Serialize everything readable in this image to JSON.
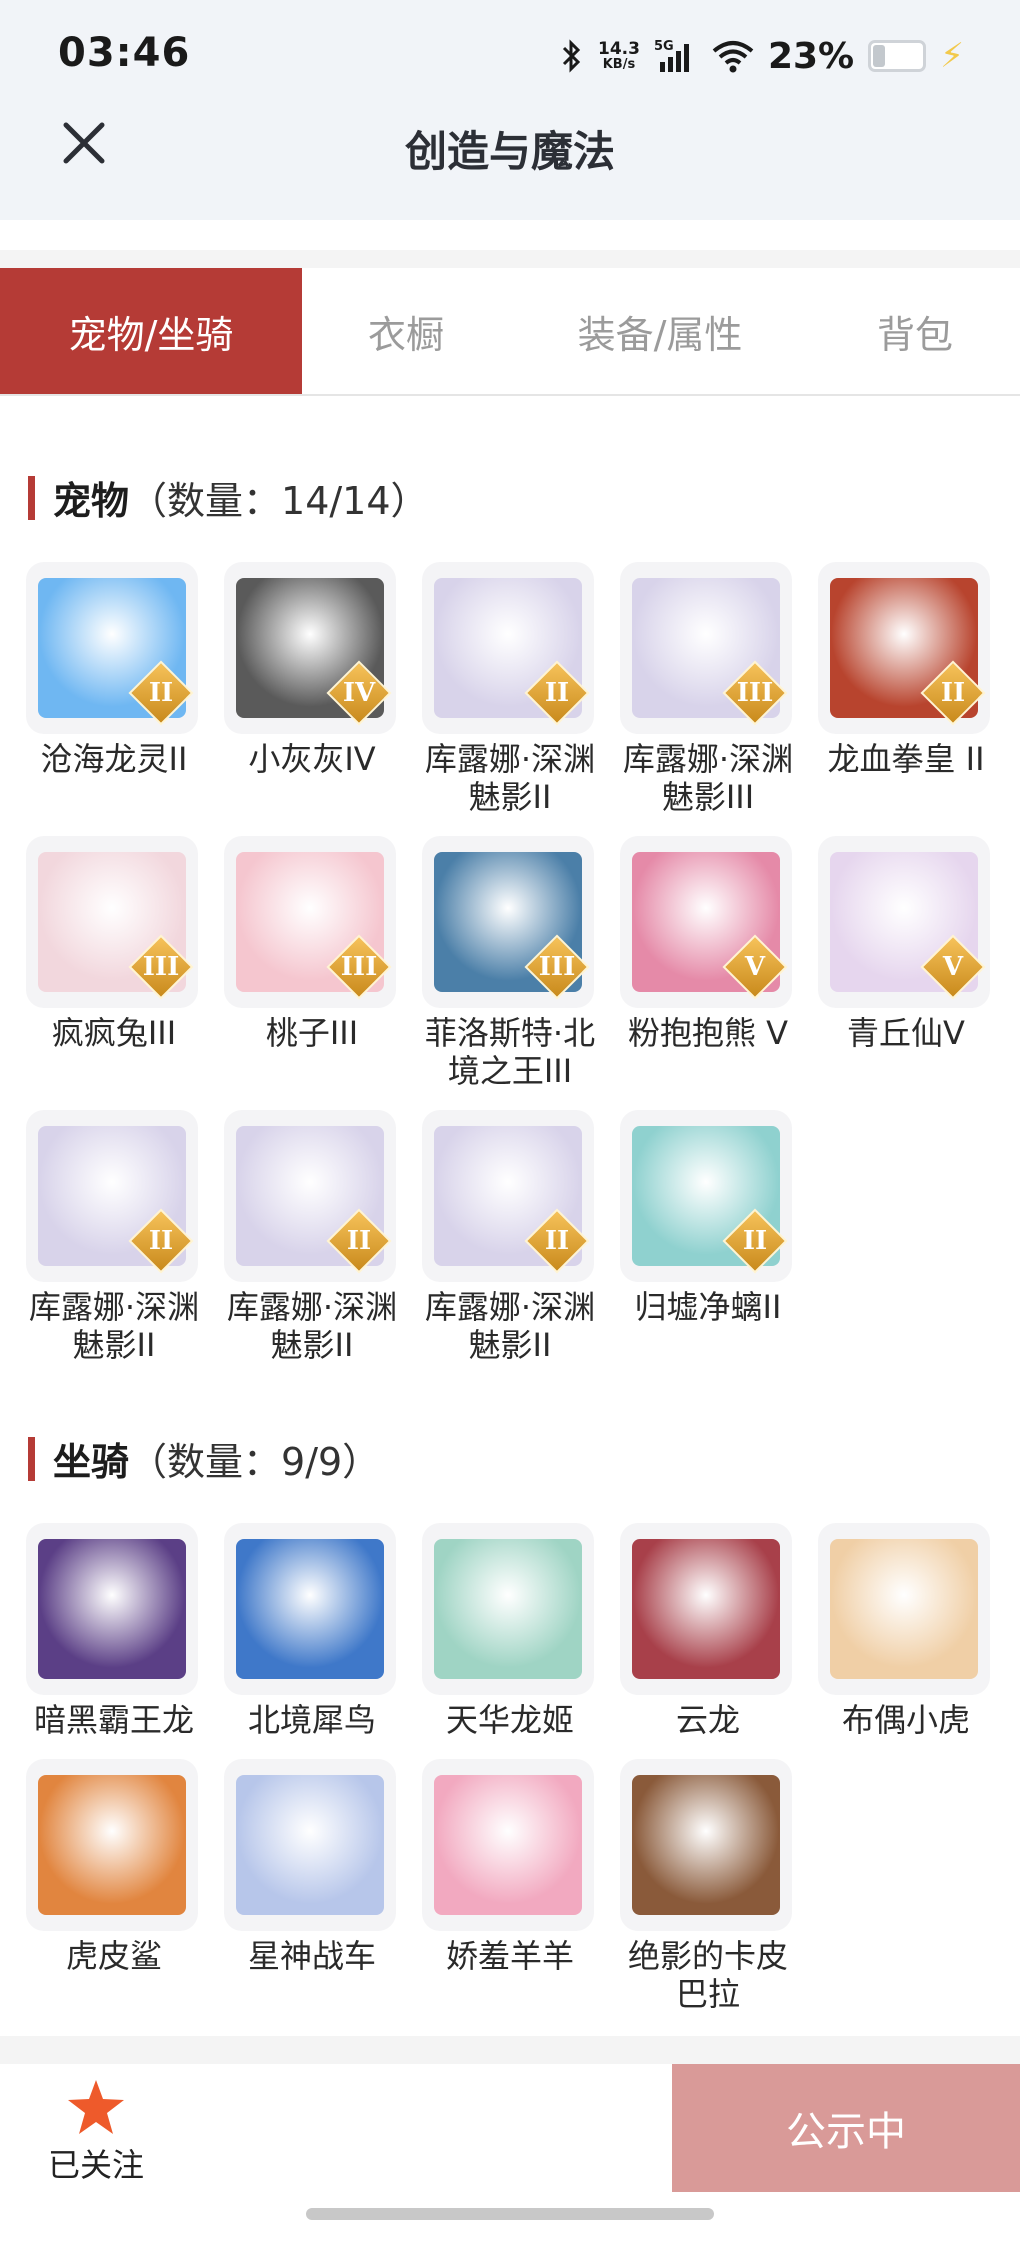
{
  "status": {
    "time": "03:46",
    "net_speed_value": "14.3",
    "net_speed_unit": "KB/s",
    "network": "5G",
    "battery_pct": "23%",
    "battery_level": 0.23
  },
  "header": {
    "title": "创造与魔法",
    "close_icon": "close-icon"
  },
  "tabs": [
    {
      "label": "宠物/坐骑",
      "active": true
    },
    {
      "label": "衣橱",
      "active": false
    },
    {
      "label": "装备/属性",
      "active": false
    },
    {
      "label": "背包",
      "active": false
    }
  ],
  "pets": {
    "title": "宠物",
    "count": "（数量：14/14）",
    "items": [
      {
        "label": "沧海龙灵II",
        "badge": "II",
        "color": "#6fb7f2"
      },
      {
        "label": "小灰灰IV",
        "badge": "IV",
        "color": "#5a5a5a"
      },
      {
        "label": "库露娜·深渊魅影II",
        "badge": "II",
        "color": "#d8d3ea"
      },
      {
        "label": "库露娜·深渊魅影III",
        "badge": "III",
        "color": "#d8d3ea"
      },
      {
        "label": "龙血拳皇 II",
        "badge": "II",
        "color": "#b8442e"
      },
      {
        "label": "疯疯兔III",
        "badge": "III",
        "color": "#f2d7dd"
      },
      {
        "label": "桃子III",
        "badge": "III",
        "color": "#f5c6cf"
      },
      {
        "label": "菲洛斯特·北境之王III",
        "badge": "III",
        "color": "#4b7fa8"
      },
      {
        "label": "粉抱抱熊 V",
        "badge": "V",
        "color": "#e58aa8"
      },
      {
        "label": "青丘仙V",
        "badge": "V",
        "color": "#e6d6ee"
      },
      {
        "label": "库露娜·深渊魅影II",
        "badge": "II",
        "color": "#d8d3ea"
      },
      {
        "label": "库露娜·深渊魅影II",
        "badge": "II",
        "color": "#d8d3ea"
      },
      {
        "label": "库露娜·深渊魅影II",
        "badge": "II",
        "color": "#d8d3ea"
      },
      {
        "label": "归墟净螭II",
        "badge": "II",
        "color": "#8fd1cf"
      }
    ]
  },
  "mounts": {
    "title": "坐骑",
    "count": "（数量：9/9）",
    "items": [
      {
        "label": "暗黑霸王龙",
        "color": "#5b3f86"
      },
      {
        "label": "北境犀鸟",
        "color": "#3f78c9"
      },
      {
        "label": "天华龙姬",
        "color": "#9fd4c4"
      },
      {
        "label": "云龙",
        "color": "#a8404a"
      },
      {
        "label": "布偶小虎",
        "color": "#f0cfa6"
      },
      {
        "label": "虎皮鲨",
        "color": "#e1853f"
      },
      {
        "label": "星神战车",
        "color": "#b7c6ea"
      },
      {
        "label": "娇羞羊羊",
        "color": "#f2a9c0"
      },
      {
        "label": "绝影的卡皮巴拉",
        "color": "#8a5a3a"
      }
    ]
  },
  "footer": {
    "follow_label": "已关注",
    "announce_label": "公示中"
  },
  "colors": {
    "accent": "#b53b36",
    "star": "#ee5a2b",
    "announce_bg": "#d99a98"
  }
}
